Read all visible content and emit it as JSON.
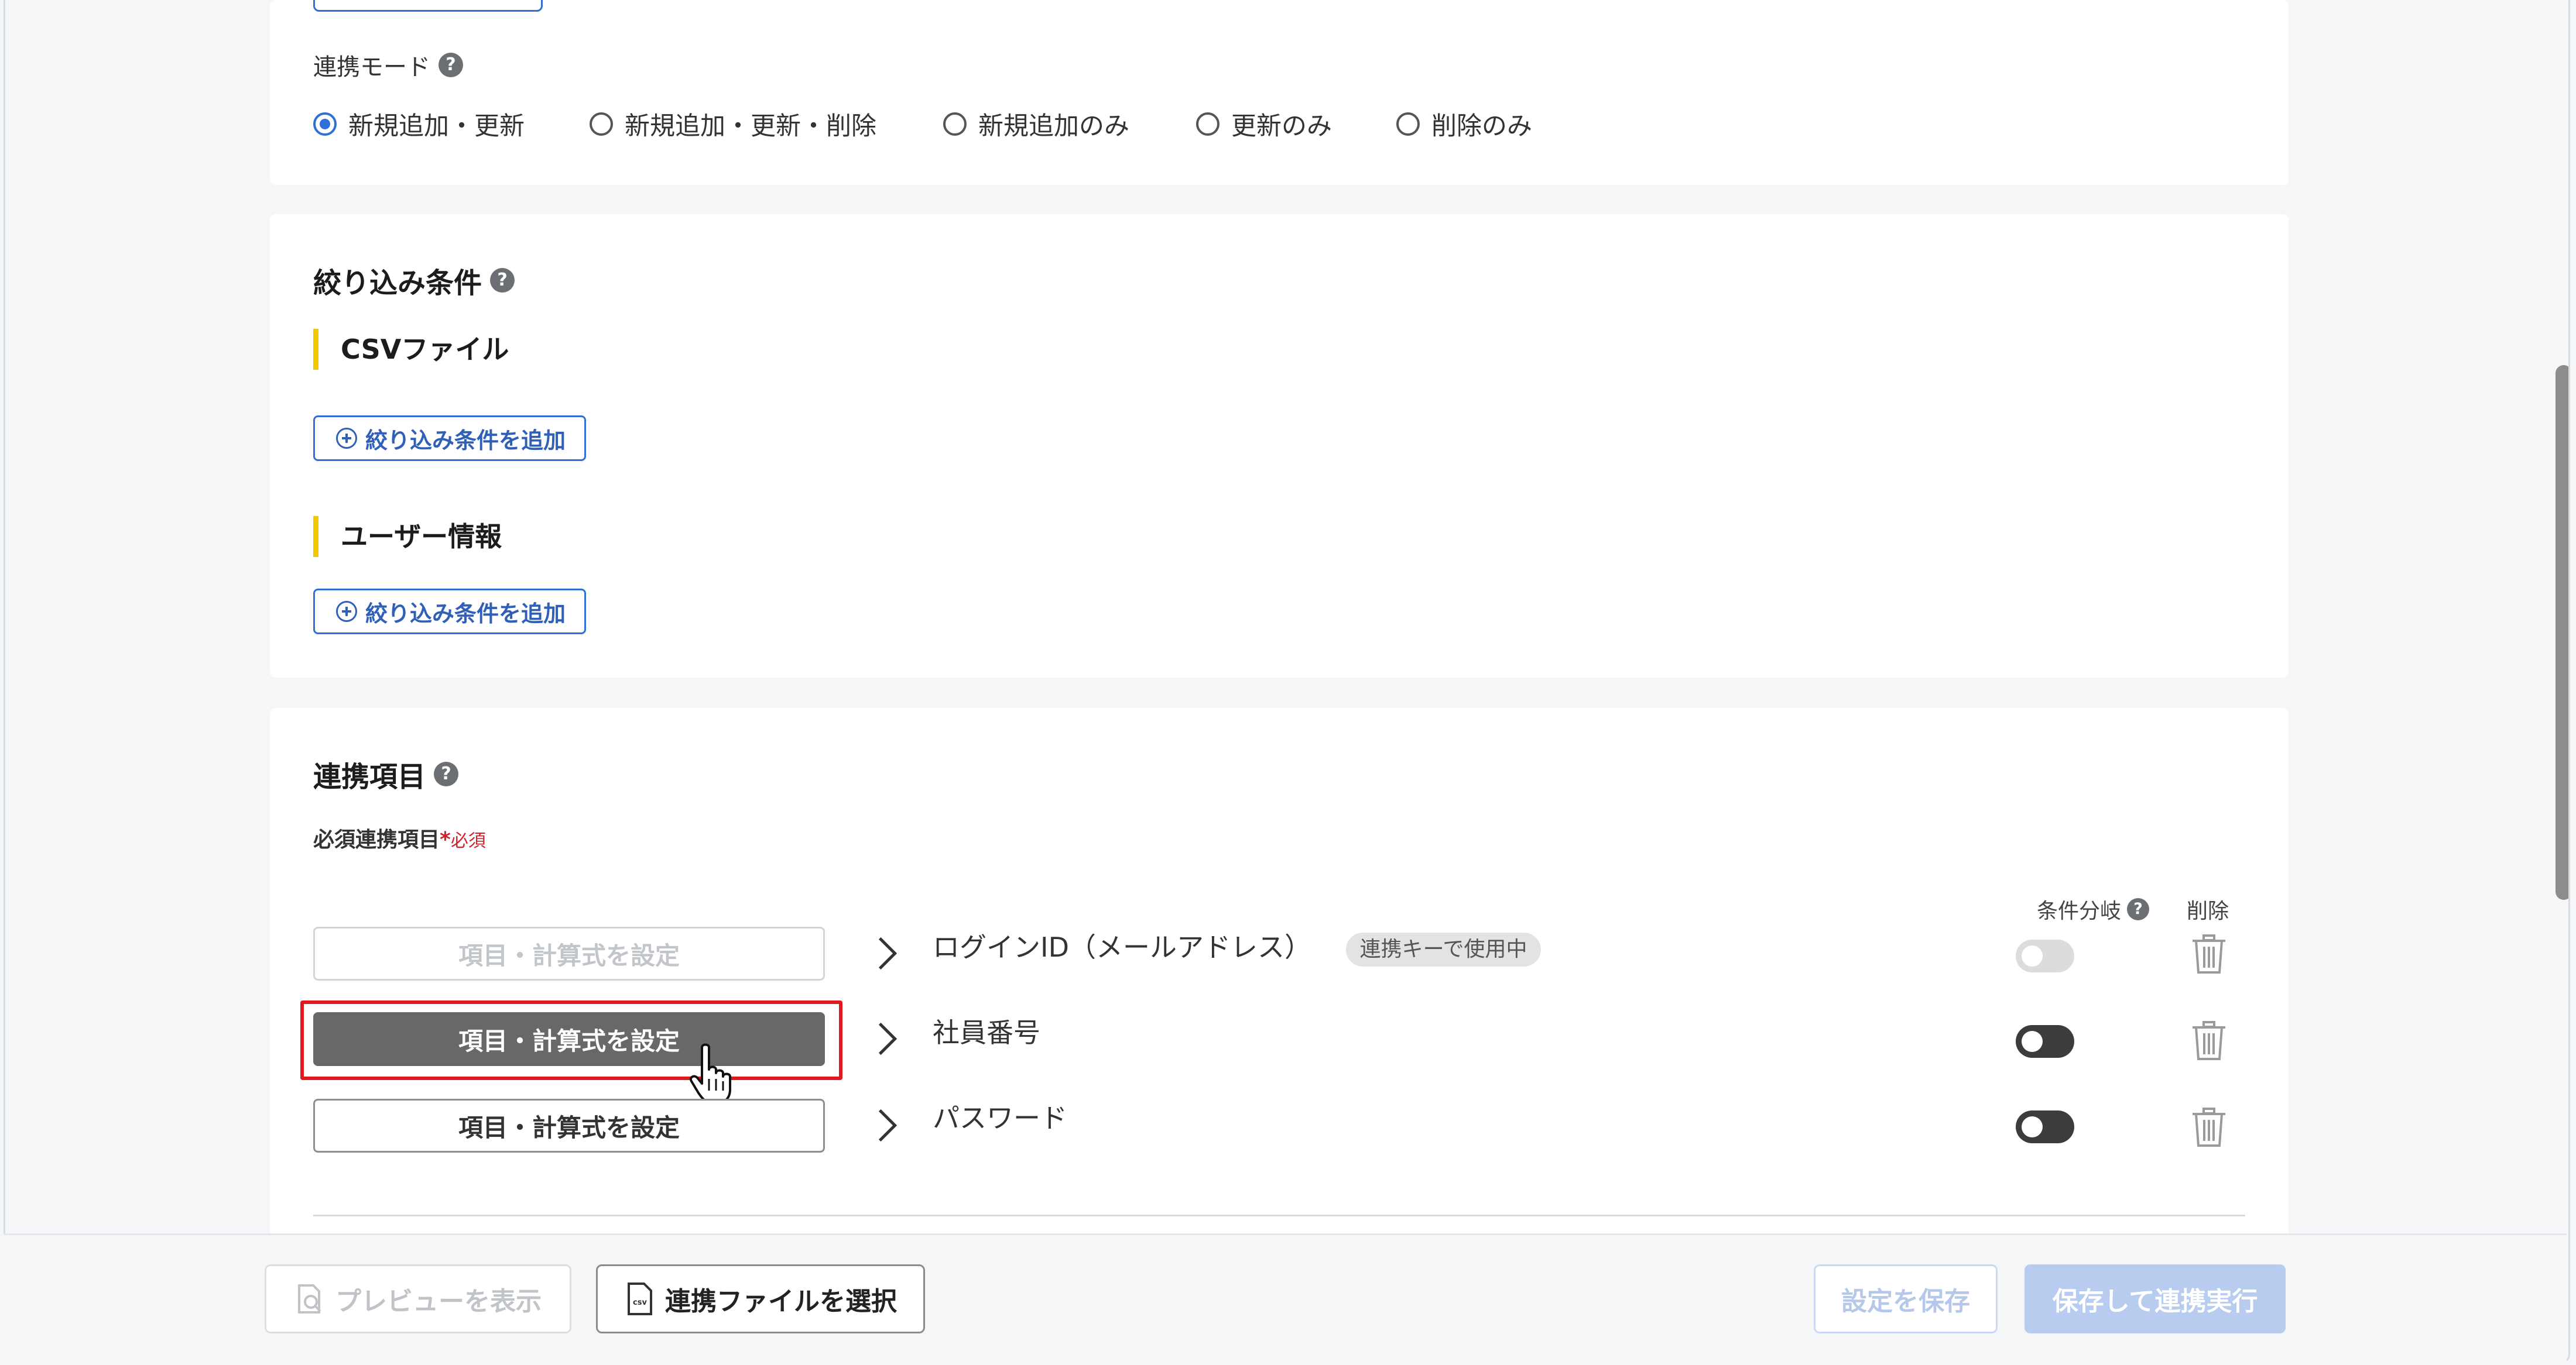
{
  "mode": {
    "label": "連携モード",
    "options": [
      "新規追加・更新",
      "新規追加・更新・削除",
      "新規追加のみ",
      "更新のみ",
      "削除のみ"
    ],
    "selected": "新規追加・更新"
  },
  "filter": {
    "title": "絞り込み条件",
    "groups": [
      {
        "label": "CSVファイル",
        "add_button": "絞り込み条件を追加"
      },
      {
        "label": "ユーザー情報",
        "add_button": "絞り込み条件を追加"
      }
    ]
  },
  "mapping": {
    "title": "連携項目",
    "required_label": "必須連携項目",
    "required_mark": "*",
    "required_note": "必須",
    "col_condition": "条件分岐",
    "col_delete": "削除",
    "rows": [
      {
        "button": "項目・計算式を設定",
        "field": "ログインID（メールアドレス）",
        "tag": "連携キーで使用中",
        "state": "disabled"
      },
      {
        "button": "項目・計算式を設定",
        "field": "社員番号",
        "tag": "",
        "state": "hover"
      },
      {
        "button": "項目・計算式を設定",
        "field": "パスワード",
        "tag": "",
        "state": "normal"
      }
    ]
  },
  "footer": {
    "preview": "プレビューを表示",
    "select_file": "連携ファイルを選択",
    "csv_icon_text": "csv",
    "save": "設定を保存",
    "save_run": "保存して連携実行"
  },
  "colors": {
    "accent": "#2f6fd6",
    "highlight": "#e0191f",
    "warning_bar": "#f2c800",
    "required": "#d0202a",
    "disabled_primary": "#b7ccee"
  }
}
